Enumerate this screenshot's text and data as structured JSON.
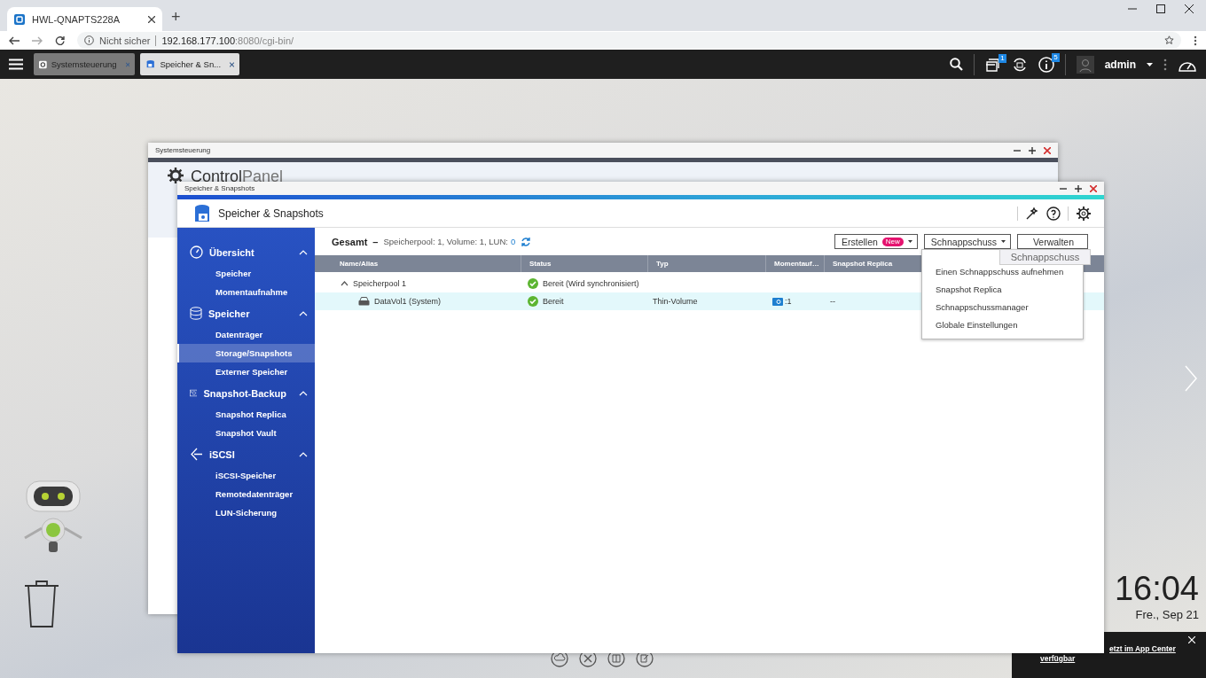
{
  "browser": {
    "tab": {
      "title": "HWL-QNAPTS228A"
    },
    "new_tab": "+",
    "address": {
      "security": "Nicht sicher",
      "host": "192.168.177.100",
      "path": ":8080/cgi-bin/"
    }
  },
  "topbar": {
    "apps": [
      {
        "title": "Systemsteuerung",
        "selected": false
      },
      {
        "title": "Speicher & Sn...",
        "selected": true
      }
    ],
    "task_badge": "1",
    "info_badge": "5",
    "user": "admin"
  },
  "control_panel": {
    "title": "Systemsteuerung",
    "logo_bold": "Control",
    "logo_light": "Panel"
  },
  "storage": {
    "title": "Speicher & Snapshots",
    "header": "Speicher & Snapshots",
    "sidebar": [
      {
        "label": "Übersicht",
        "expanded": true,
        "children": [
          {
            "label": "Speicher",
            "selected": false
          },
          {
            "label": "Momentaufnahme",
            "selected": false
          }
        ]
      },
      {
        "label": "Speicher",
        "expanded": true,
        "children": [
          {
            "label": "Datenträger",
            "selected": false
          },
          {
            "label": "Storage/Snapshots",
            "selected": true
          },
          {
            "label": "Externer Speicher",
            "selected": false
          }
        ]
      },
      {
        "label": "Snapshot-Backup",
        "expanded": true,
        "children": [
          {
            "label": "Snapshot Replica",
            "selected": false
          },
          {
            "label": "Snapshot Vault",
            "selected": false
          }
        ]
      },
      {
        "label": "iSCSI",
        "expanded": true,
        "children": [
          {
            "label": "iSCSI-Speicher",
            "selected": false
          },
          {
            "label": "Remotedatenträger",
            "selected": false
          },
          {
            "label": "LUN-Sicherung",
            "selected": false
          }
        ]
      }
    ],
    "summary": {
      "label": "Gesamt",
      "dash": "–",
      "detail": "Speicherpool: 1, Volume: 1, LUN:",
      "lun": "0"
    },
    "buttons": [
      {
        "label": "Erstellen",
        "badge": "New",
        "dropdown": true
      },
      {
        "label": "Schnappschuss",
        "dropdown": true
      },
      {
        "label": "Verwalten",
        "dropdown": false
      }
    ],
    "tooltip": "Schnappschuss",
    "columns": [
      "Name/Alias",
      "Status",
      "Typ",
      "Momentauf…",
      "Snapshot Replica"
    ],
    "rows": [
      {
        "kind": "pool",
        "name": "Speicherpool 1",
        "status": "Bereit (Wird synchronisiert)",
        "selected": false
      },
      {
        "kind": "volume",
        "name": "DataVol1 (System)",
        "status": "Bereit",
        "type": "Thin-Volume",
        "snapshots": ":1",
        "replica": "--",
        "selected": true
      }
    ],
    "menu": [
      "Einen Schnappschuss aufnehmen",
      "Snapshot Replica",
      "Schnappschussmanager",
      "Globale Einstellungen"
    ]
  },
  "desktop": {
    "clock": "16:04",
    "date": "Fre., Sep 21",
    "notification": [
      "etzt im App Center",
      "verfügbar"
    ]
  }
}
